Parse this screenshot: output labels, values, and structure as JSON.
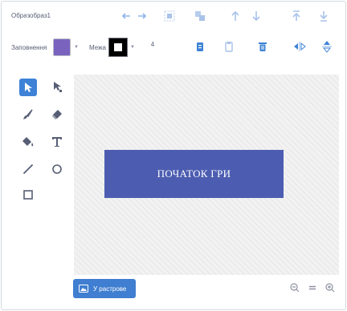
{
  "header": {
    "costume_label": "Образ",
    "costume_name": "образ1",
    "fill_label": "Заповнення",
    "outline_label": "Межа",
    "stroke_width": "4"
  },
  "colors": {
    "fill": "#7a63bf",
    "outline": "#000000",
    "accent": "#3d82d6",
    "shape": "#4c5db1"
  },
  "toolbar": {
    "row1_icons": [
      "undo-icon",
      "redo-icon",
      "group-icon",
      "ungroup-icon",
      "forward-icon",
      "backward-icon",
      "front-icon",
      "back-icon"
    ],
    "row2_icons": [
      "copy-icon",
      "paste-icon",
      "delete-icon",
      "flip-horizontal-icon",
      "flip-vertical-icon"
    ]
  },
  "tools": [
    "select-icon",
    "reshape-icon",
    "brush-icon",
    "eraser-icon",
    "fill-icon",
    "text-icon",
    "line-icon",
    "circle-icon",
    "rectangle-icon"
  ],
  "canvas": {
    "shape_text": "ПОЧАТОК ГРИ"
  },
  "footer": {
    "convert_label": "У растрове",
    "zoom_icons": [
      "zoom-out-icon",
      "zoom-reset-icon",
      "zoom-in-icon"
    ]
  }
}
